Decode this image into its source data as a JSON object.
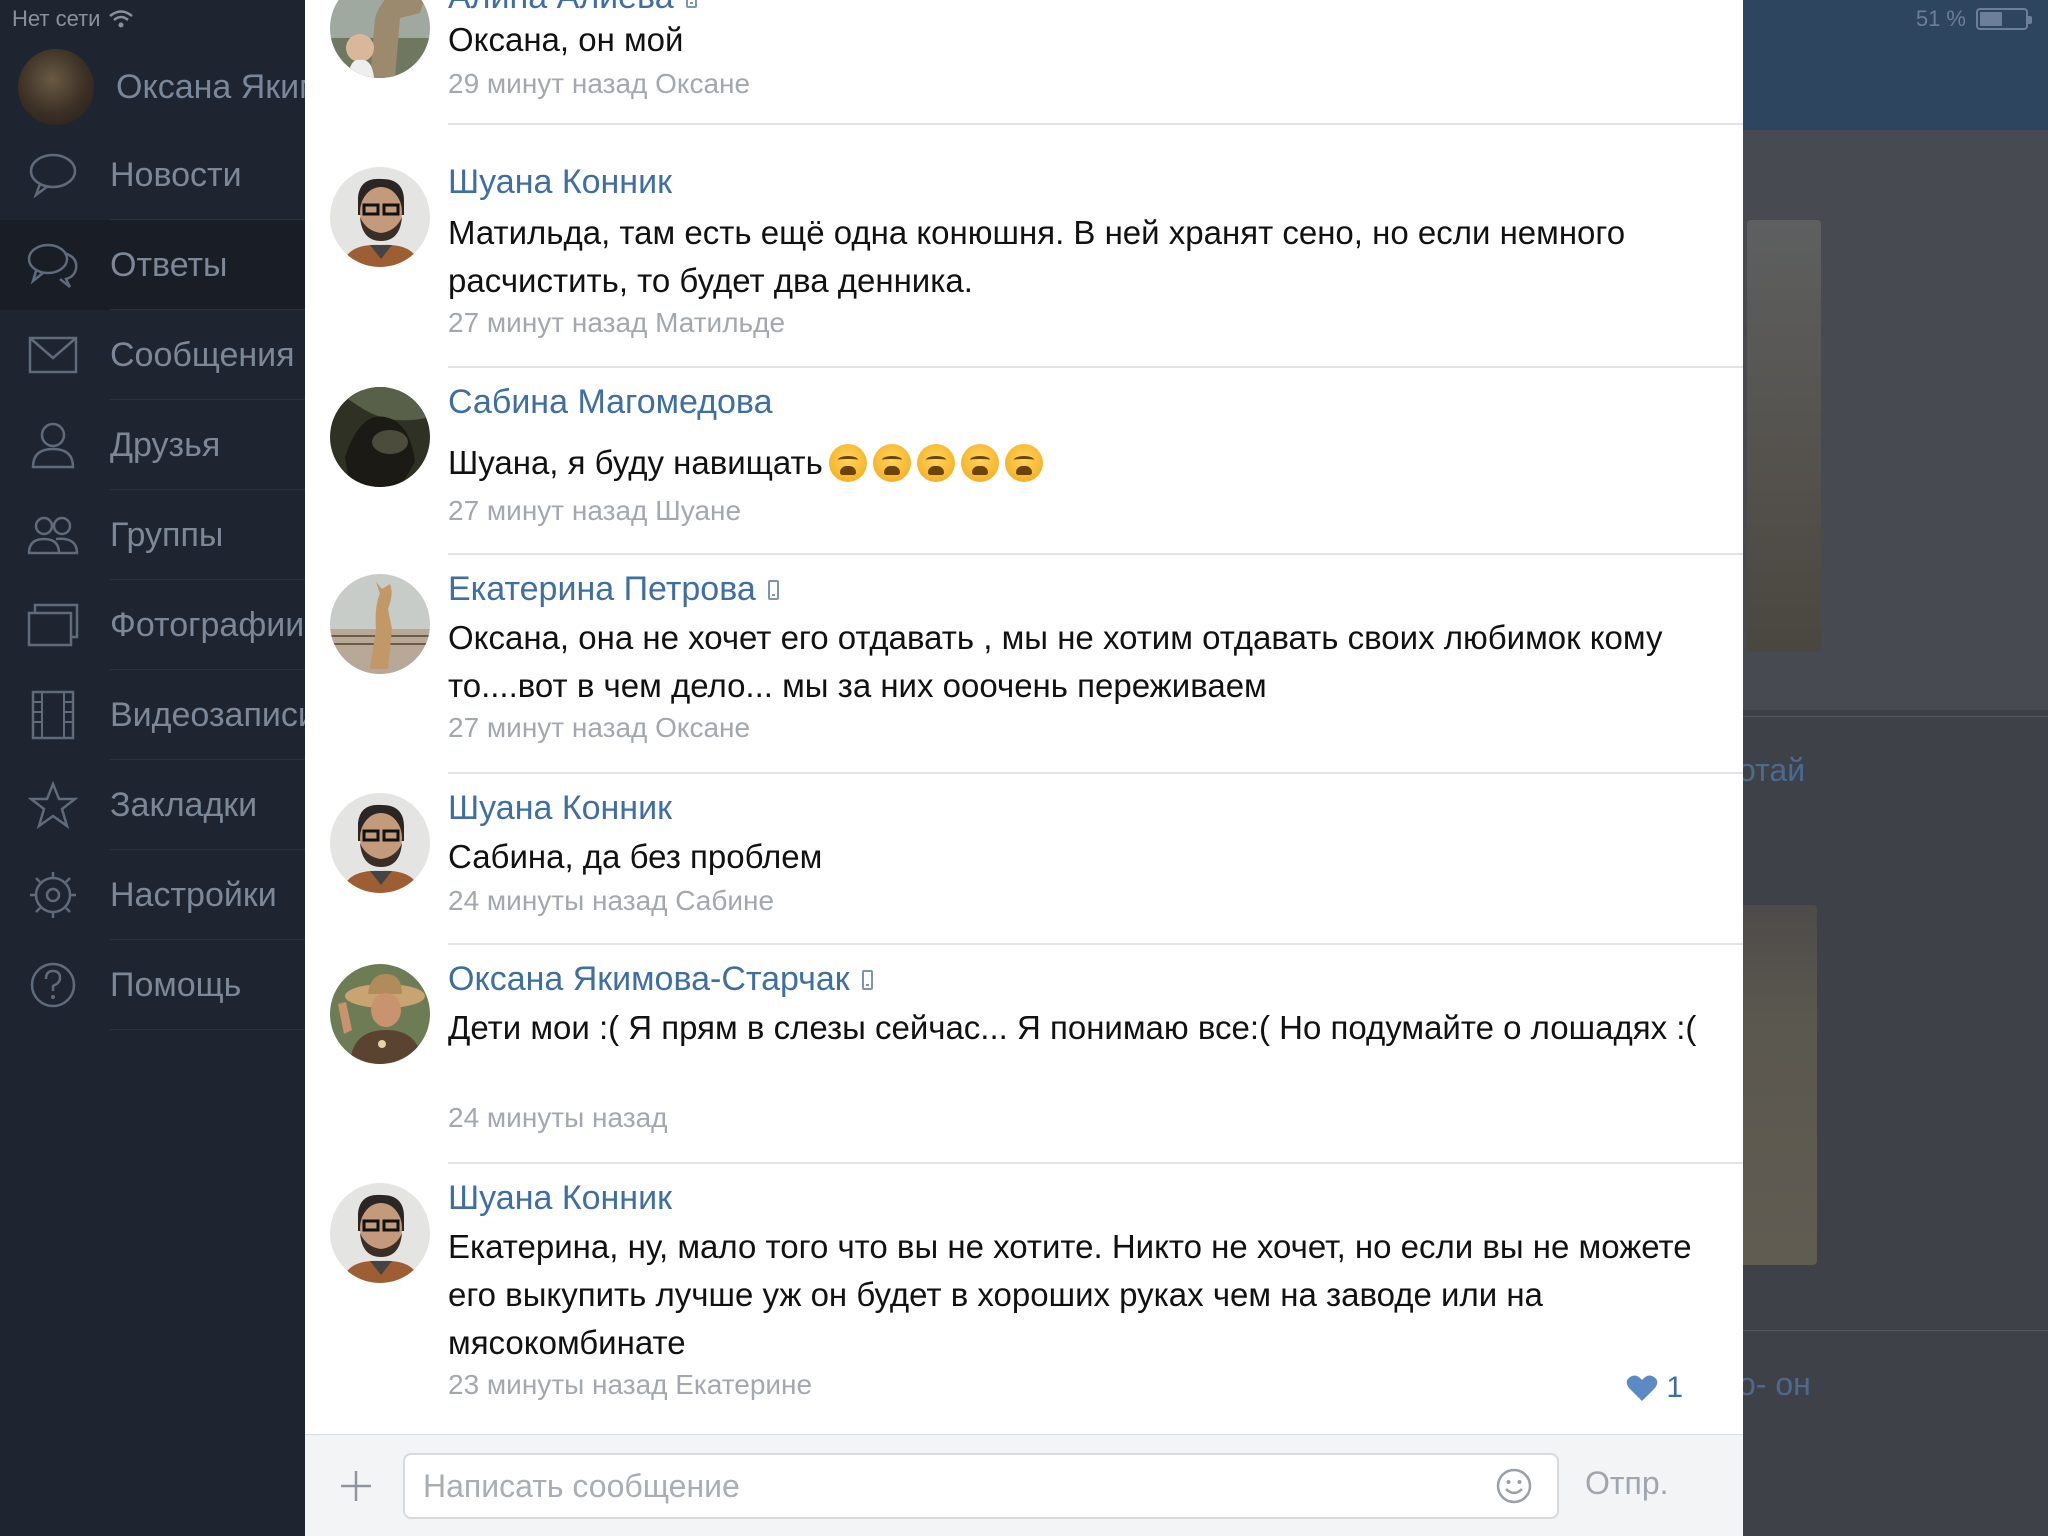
{
  "status_bar": {
    "carrier": "Нет сети",
    "battery_text": "51 %",
    "battery_level": 0.51
  },
  "sidebar": {
    "profile_name": "Оксана Якимова",
    "items": [
      {
        "label": "Новости",
        "icon": "news-icon",
        "active": false
      },
      {
        "label": "Ответы",
        "icon": "replies-icon",
        "active": true
      },
      {
        "label": "Сообщения",
        "icon": "messages-icon",
        "active": false
      },
      {
        "label": "Друзья",
        "icon": "friends-icon",
        "active": false
      },
      {
        "label": "Группы",
        "icon": "groups-icon",
        "active": false
      },
      {
        "label": "Фотографии",
        "icon": "photos-icon",
        "active": false
      },
      {
        "label": "Видеозаписи",
        "icon": "videos-icon",
        "active": false
      },
      {
        "label": "Закладки",
        "icon": "bookmarks-icon",
        "active": false
      },
      {
        "label": "Настройки",
        "icon": "settings-icon",
        "active": false
      },
      {
        "label": "Помощь",
        "icon": "help-icon",
        "active": false
      }
    ]
  },
  "background_feed": {
    "snippet_1": "отай",
    "snippet_2": "о- он"
  },
  "comments": [
    {
      "author": "Алина Алиева",
      "mobile": true,
      "text": "Оксана, он мой",
      "meta": "29 минут назад Оксане",
      "avatar": "horse-photo"
    },
    {
      "author": "Шуана Конник",
      "mobile": false,
      "text": "Матильда, там есть ещё одна конюшня. В ней хранят сено, но если немного расчистить, то будет два денника.",
      "meta": "27 минут назад Матильде",
      "avatar": "man-glasses"
    },
    {
      "author": "Сабина Магомедова",
      "mobile": false,
      "text": "Шуана, я буду навищать",
      "emoji_count": 5,
      "meta": "27 минут назад Шуане",
      "avatar": "dark-photo"
    },
    {
      "author": "Екатерина Петрова",
      "mobile": true,
      "text": "Оксана, она не хочет его отдавать , мы не хотим отдавать своих любимок кому то....вот в чем дело... мы за них ооочень переживаем",
      "meta": "27 минут назад Оксане",
      "avatar": "rearing-horse"
    },
    {
      "author": "Шуана Конник",
      "mobile": false,
      "text": "Сабина, да без проблем",
      "meta": "24 минуты назад Сабине",
      "avatar": "man-glasses"
    },
    {
      "author": "Оксана Якимова-Старчак",
      "mobile": true,
      "text": "Дети мои :( Я прям в слезы сейчас... Я понимаю все:( Но подумайте о лошадях :(",
      "meta": "24 минуты назад",
      "avatar": "woman-hat"
    },
    {
      "author": "Шуана Конник",
      "mobile": false,
      "text": "Екатерина, ну, мало того что вы не хотите. Никто не хочет, но если вы не можете его выкупить лучше уж он будет в хороших руках чем на заводе или на мясокомбинате",
      "meta": "23 минуты назад Екатерине",
      "avatar": "man-glasses",
      "likes": "1"
    }
  ],
  "composer": {
    "placeholder": "Написать сообщение",
    "send_label": "Отпр."
  },
  "colors": {
    "link": "#3f6ea3",
    "meta": "#a3a8ae",
    "sidebar_bg": "#1f2530"
  }
}
